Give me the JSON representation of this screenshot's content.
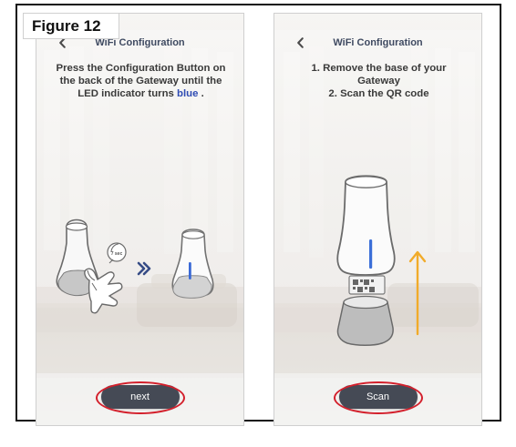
{
  "figure": {
    "label": "Figure 12"
  },
  "left_screen": {
    "title": "WiFi Configuration",
    "instruction": {
      "line1": "Press the Configuration Button on",
      "line2": "the back of the Gateway until the",
      "line3_prefix": "LED indicator turns ",
      "line3_highlight": "blue",
      "line3_suffix": " ."
    },
    "timer_badge": "7 sec",
    "button_label": "next"
  },
  "right_screen": {
    "title": "WiFi Configuration",
    "instruction": {
      "line1": "1. Remove the base of your Gateway",
      "line2": "2. Scan the QR code"
    },
    "button_label": "Scan"
  },
  "colors": {
    "accent_blue": "#2e4bb3",
    "button_bg": "#454a55",
    "ring_red": "#d31f2b",
    "arrow_orange": "#f1ab2a"
  },
  "icons": {
    "back": "back-chevron-icon",
    "forward": "double-chevron-right-icon",
    "hand": "hand-pointer-icon",
    "timer": "timer-icon",
    "qr": "qr-code-icon",
    "arrow_up": "arrow-up-icon"
  }
}
